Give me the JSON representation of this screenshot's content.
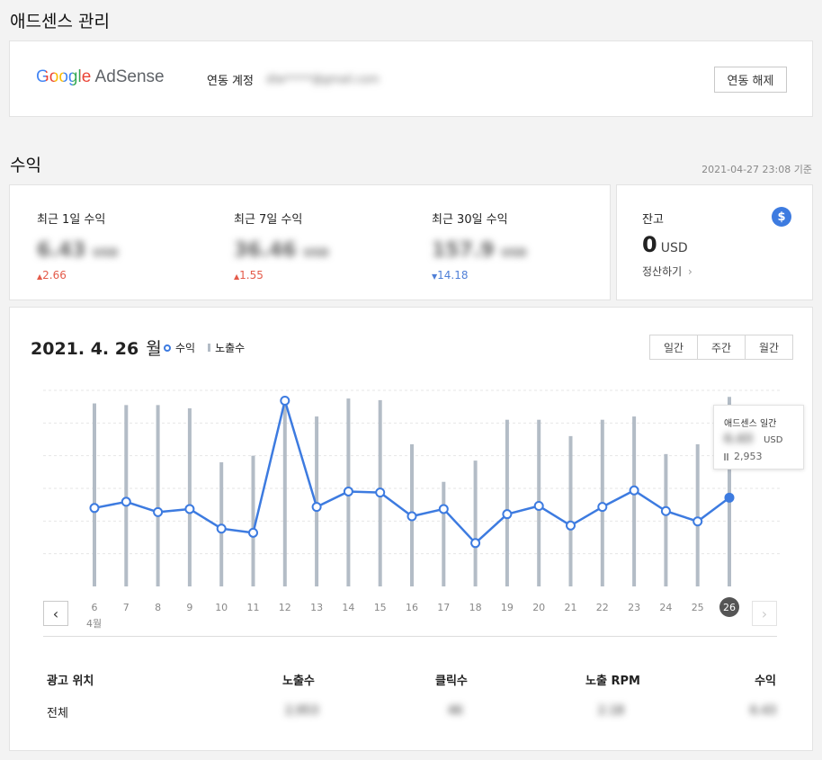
{
  "header": {
    "title": "애드센스 관리"
  },
  "account": {
    "logo_google": "Google",
    "logo_adsense": "AdSense",
    "label": "연동 계정",
    "email": "dlw*****@gmail.com",
    "unlink_label": "연동 해제"
  },
  "revenue": {
    "title": "수익",
    "timestamp": "2021-04-27 23:08 기준",
    "stats": [
      {
        "label": "최근 1일 수익",
        "value": "6.43",
        "unit": "USD",
        "delta": "2.66",
        "dir": "up"
      },
      {
        "label": "최근 7일 수익",
        "value": "36.46",
        "unit": "USD",
        "delta": "1.55",
        "dir": "up"
      },
      {
        "label": "최근 30일 수익",
        "value": "157.9",
        "unit": "USD",
        "delta": "14.18",
        "dir": "down"
      }
    ],
    "balance": {
      "label": "잔고",
      "value": "0",
      "unit": "USD",
      "settle_label": "정산하기",
      "chevron": "›",
      "icon_glyph": "$"
    }
  },
  "chart_panel": {
    "date": "2021. 4. 26",
    "weekday": "월",
    "legend_revenue": "수익",
    "legend_impressions": "노출수",
    "tabs": [
      "일간",
      "주간",
      "월간"
    ],
    "active_tab": 0,
    "tooltip": {
      "title": "애드센스 일간",
      "value": "6.43",
      "unit": "USD",
      "impressions": "2,953"
    },
    "month_label": "4월"
  },
  "chart_data": {
    "type": "line",
    "x": [
      6,
      7,
      8,
      9,
      10,
      11,
      12,
      13,
      14,
      15,
      16,
      17,
      18,
      19,
      20,
      21,
      22,
      23,
      24,
      25,
      26
    ],
    "selected_x": 26,
    "series": [
      {
        "name": "수익",
        "kind": "line",
        "color": "#3d7be0",
        "values": [
          3.8,
          4.1,
          3.6,
          3.75,
          2.8,
          2.6,
          9.0,
          3.85,
          4.6,
          4.55,
          3.4,
          3.75,
          2.1,
          3.5,
          3.9,
          2.95,
          3.85,
          4.65,
          3.65,
          3.15,
          4.3
        ]
      },
      {
        "name": "노출수",
        "kind": "bar",
        "color": "#b3bcc6",
        "values": [
          5.6,
          5.55,
          5.55,
          5.45,
          3.8,
          4.0,
          5.65,
          5.2,
          5.75,
          5.7,
          4.35,
          3.2,
          3.85,
          5.1,
          5.1,
          4.6,
          5.1,
          5.2,
          4.05,
          4.35,
          5.8
        ]
      }
    ],
    "grid": true
  },
  "table": {
    "headers": [
      "광고 위치",
      "노출수",
      "클릭수",
      "노출 RPM",
      "수익"
    ],
    "rows": [
      [
        "전체",
        "2,953",
        "46",
        "2.18",
        "6.43"
      ]
    ]
  },
  "icons": {
    "prev": "chevron-left-icon",
    "next": "chevron-right-icon",
    "dollar": "dollar-icon"
  },
  "colors": {
    "accent": "#3d7be0",
    "up": "#e45b4a",
    "down": "#4f7fd7",
    "bar": "#b3bcc6"
  }
}
